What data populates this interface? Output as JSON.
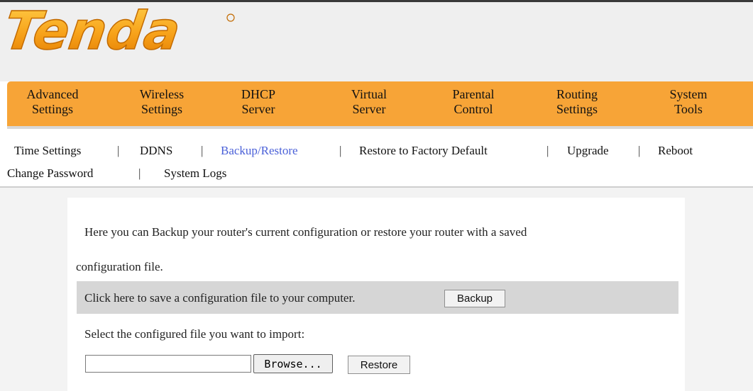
{
  "logo": {
    "text": "Tenda"
  },
  "nav": {
    "items": [
      {
        "line1": "Advanced",
        "line2": "Settings"
      },
      {
        "line1": "Wireless",
        "line2": "Settings"
      },
      {
        "line1": "DHCP",
        "line2": "Server"
      },
      {
        "line1": "Virtual",
        "line2": "Server"
      },
      {
        "line1": "Parental",
        "line2": "Control"
      },
      {
        "line1": "Routing",
        "line2": "Settings"
      },
      {
        "line1": "System",
        "line2": "Tools"
      }
    ]
  },
  "subnav": {
    "items": [
      "Time Settings",
      "DDNS",
      "Backup/Restore",
      "Restore to Factory Default",
      "Upgrade",
      "Reboot",
      "Change Password",
      "System Logs"
    ],
    "separator": "|"
  },
  "content": {
    "intro_line1": "Here you can Backup your router's current configuration or restore your router with a saved",
    "intro_line2": "configuration file.",
    "save_prompt": "Click here to save a configuration file to your computer.",
    "backup_label": "Backup",
    "import_prompt": "Select the configured file you want to import:",
    "file_value": "",
    "browse_label": "Browse...",
    "restore_label": "Restore"
  }
}
